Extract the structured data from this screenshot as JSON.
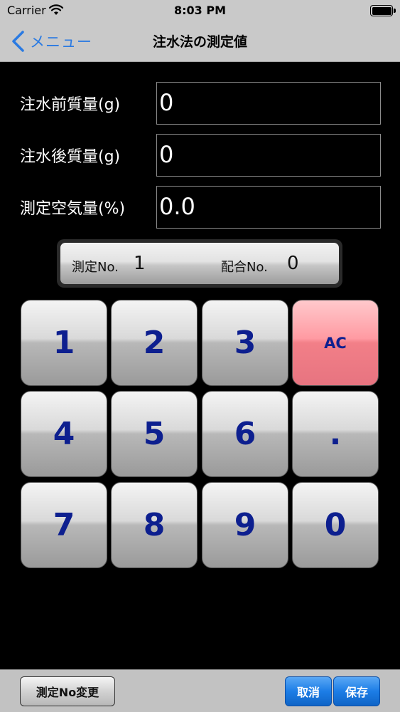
{
  "status_bar": {
    "carrier": "Carrier",
    "time": "8:03 PM"
  },
  "nav": {
    "back_label": "メニュー",
    "title": "注水法の測定値"
  },
  "fields": [
    {
      "label": "注水前質量(g)",
      "value": "0"
    },
    {
      "label": "注水後質量(g)",
      "value": "0"
    },
    {
      "label": "測定空気量(%)",
      "value": "0.0"
    }
  ],
  "info": {
    "measure_label": "測定No.",
    "measure_value": "1",
    "mix_label": "配合No.",
    "mix_value": "0"
  },
  "keypad": [
    "1",
    "2",
    "3",
    "AC",
    "4",
    "5",
    "6",
    ".",
    "7",
    "8",
    "9",
    "0"
  ],
  "toolbar": {
    "change_label": "測定No変更",
    "cancel_label": "取消",
    "save_label": "保存"
  },
  "colors": {
    "accent": "#2a7ae2",
    "key_text": "#0d1f8f",
    "ac_key": "#ff9aa2",
    "toolbar_button": "#1c7de6"
  }
}
